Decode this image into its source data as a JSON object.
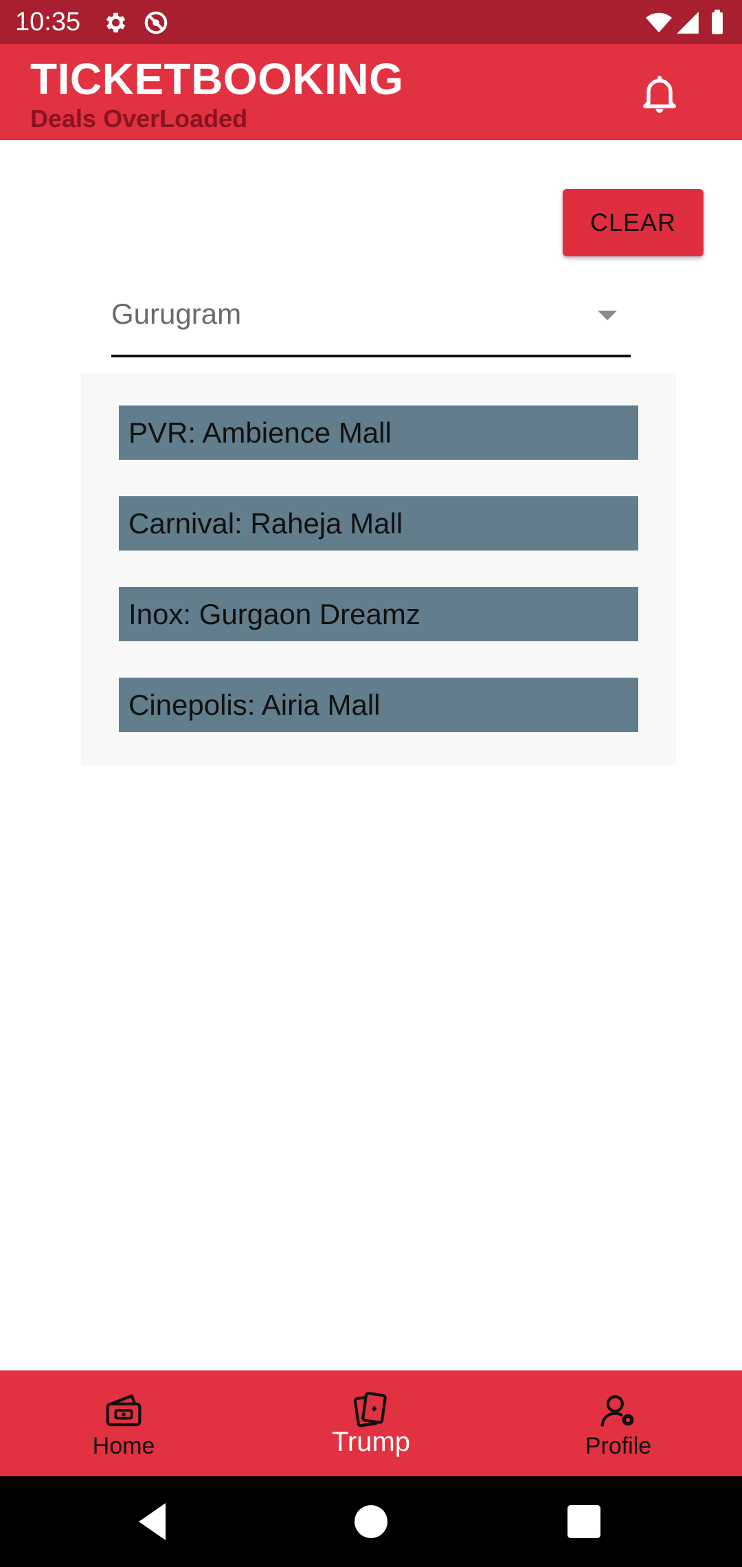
{
  "status_bar": {
    "time": "10:35",
    "icons": [
      "gear-icon",
      "no-disturb-icon",
      "wifi-icon",
      "signal-icon",
      "battery-icon"
    ]
  },
  "app_bar": {
    "title": "TICKETBOOKING",
    "subtitle": "Deals OverLoaded",
    "action_icon": "bell-icon"
  },
  "clear_button": {
    "label": "CLEAR"
  },
  "city_dropdown": {
    "selected": "Gurugram"
  },
  "cinema_list": {
    "items": [
      "PVR: Ambience Mall",
      "Carnival: Raheja Mall",
      "Inox: Gurgaon Dreamz",
      "Cinepolis: Airia Mall"
    ]
  },
  "bottom_nav": {
    "items": [
      {
        "label": "Home",
        "icon": "ticket-icon",
        "active": false
      },
      {
        "label": "Trump",
        "icon": "cards-icon",
        "active": true
      },
      {
        "label": "Profile",
        "icon": "user-settings-icon",
        "active": false
      }
    ]
  },
  "system_nav": {
    "buttons": [
      "back-icon",
      "home-circle-icon",
      "recents-square-icon"
    ]
  },
  "colors": {
    "status_bar": "#a81f2f",
    "primary": "#e23140",
    "list_item": "#627d8b",
    "subtitle": "#8a1420"
  }
}
